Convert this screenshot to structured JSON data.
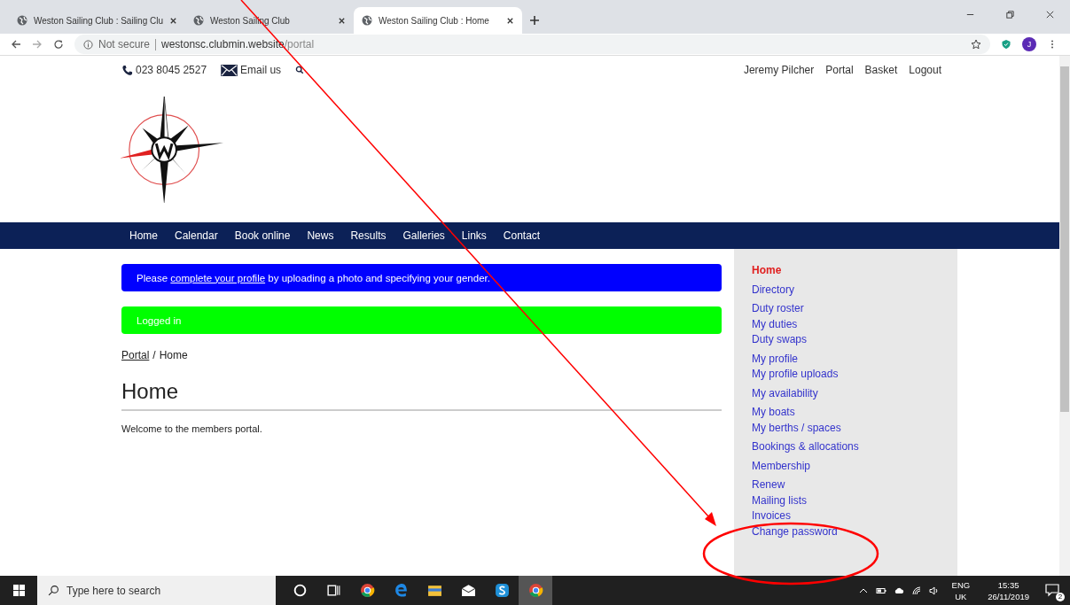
{
  "browser": {
    "tabs": [
      {
        "title": "Weston Sailing Club : Sailing Clu",
        "selected": false
      },
      {
        "title": "Weston Sailing Club",
        "selected": false
      },
      {
        "title": "Weston Sailing Club : Home",
        "selected": true
      }
    ],
    "security": "Not secure",
    "url_host": "westonsc.clubmin.website",
    "url_path": "/portal",
    "profile_initial": "J"
  },
  "header": {
    "phone": "023 8045 2527",
    "email": "Email us",
    "user_links": [
      "Jeremy Pilcher",
      "Portal",
      "Basket",
      "Logout"
    ]
  },
  "nav": [
    "Home",
    "Calendar",
    "Book online",
    "News",
    "Results",
    "Galleries",
    "Links",
    "Contact"
  ],
  "alerts": [
    {
      "kind": "info",
      "before": "Please ",
      "link": "complete your profile",
      "after": " by uploading a photo and specifying your gender."
    },
    {
      "kind": "success",
      "text": "Logged in"
    }
  ],
  "breadcrumb": {
    "link": "Portal",
    "separator": "/",
    "current": "Home"
  },
  "heading": "Home",
  "body": "Welcome to the members portal.",
  "sidebar": {
    "groups": [
      [
        {
          "label": "Home",
          "selected": true
        }
      ],
      [
        {
          "label": "Directory",
          "selected": false
        }
      ],
      [
        {
          "label": "Duty roster",
          "selected": false
        },
        {
          "label": "My duties",
          "selected": false
        },
        {
          "label": "Duty swaps",
          "selected": false
        }
      ],
      [
        {
          "label": "My profile",
          "selected": false
        },
        {
          "label": "My profile uploads",
          "selected": false
        }
      ],
      [
        {
          "label": "My availability",
          "selected": false
        }
      ],
      [
        {
          "label": "My boats",
          "selected": false
        },
        {
          "label": "My berths / spaces",
          "selected": false
        }
      ],
      [
        {
          "label": "Bookings & allocations",
          "selected": false
        }
      ],
      [
        {
          "label": "Membership",
          "selected": false
        }
      ],
      [
        {
          "label": "Renew",
          "selected": false
        },
        {
          "label": "Mailing lists",
          "selected": false
        },
        {
          "label": "Invoices",
          "selected": false
        },
        {
          "label": "Change password",
          "selected": false
        }
      ]
    ]
  },
  "taskbar": {
    "search_placeholder": "Type here to search",
    "language": "ENG",
    "region": "UK",
    "time": "15:35",
    "date": "26/11/2019",
    "notifications": "2"
  }
}
